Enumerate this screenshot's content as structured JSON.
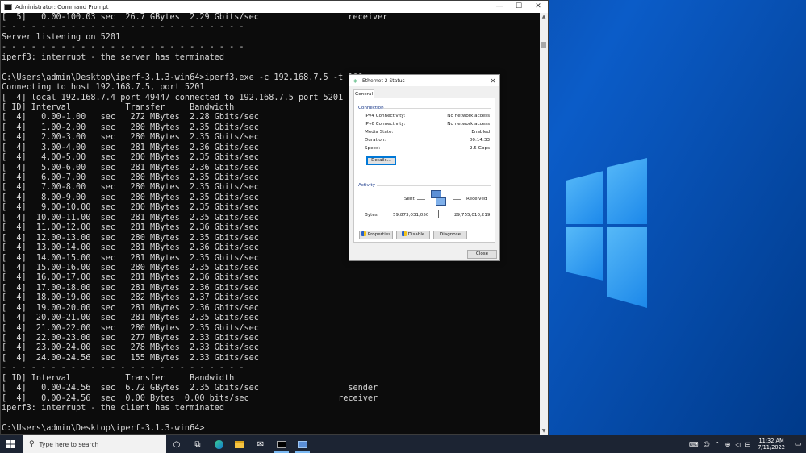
{
  "console": {
    "title": "Administrator: Command Prompt",
    "controls": {
      "minimize": "—",
      "maximize": "☐",
      "close": "✕"
    },
    "lines": [
      "[  5]   0.00-100.03 sec  26.7 GBytes  2.29 Gbits/sec                  receiver",
      "- - - - - - - - - - - - - - - - - - - - - - - - -",
      "Server listening on 5201",
      "- - - - - - - - - - - - - - - - - - - - - - - - -",
      "iperf3: interrupt - the server has terminated",
      "",
      "C:\\Users\\admin\\Desktop\\iperf-3.1.3-win64>iperf3.exe -c 192.168.7.5 -t 100",
      "Connecting to host 192.168.7.5, port 5201",
      "[  4] local 192.168.7.4 port 49447 connected to 192.168.7.5 port 5201",
      "[ ID] Interval           Transfer     Bandwidth",
      "[  4]   0.00-1.00   sec   272 MBytes  2.28 Gbits/sec",
      "[  4]   1.00-2.00   sec   280 MBytes  2.35 Gbits/sec",
      "[  4]   2.00-3.00   sec   280 MBytes  2.35 Gbits/sec",
      "[  4]   3.00-4.00   sec   281 MBytes  2.36 Gbits/sec",
      "[  4]   4.00-5.00   sec   280 MBytes  2.35 Gbits/sec",
      "[  4]   5.00-6.00   sec   281 MBytes  2.36 Gbits/sec",
      "[  4]   6.00-7.00   sec   280 MBytes  2.35 Gbits/sec",
      "[  4]   7.00-8.00   sec   280 MBytes  2.35 Gbits/sec",
      "[  4]   8.00-9.00   sec   280 MBytes  2.35 Gbits/sec",
      "[  4]   9.00-10.00  sec   280 MBytes  2.35 Gbits/sec",
      "[  4]  10.00-11.00  sec   281 MBytes  2.35 Gbits/sec",
      "[  4]  11.00-12.00  sec   281 MBytes  2.36 Gbits/sec",
      "[  4]  12.00-13.00  sec   280 MBytes  2.35 Gbits/sec",
      "[  4]  13.00-14.00  sec   281 MBytes  2.36 Gbits/sec",
      "[  4]  14.00-15.00  sec   281 MBytes  2.35 Gbits/sec",
      "[  4]  15.00-16.00  sec   280 MBytes  2.35 Gbits/sec",
      "[  4]  16.00-17.00  sec   281 MBytes  2.36 Gbits/sec",
      "[  4]  17.00-18.00  sec   281 MBytes  2.36 Gbits/sec",
      "[  4]  18.00-19.00  sec   282 MBytes  2.37 Gbits/sec",
      "[  4]  19.00-20.00  sec   281 MBytes  2.36 Gbits/sec",
      "[  4]  20.00-21.00  sec   281 MBytes  2.35 Gbits/sec",
      "[  4]  21.00-22.00  sec   280 MBytes  2.35 Gbits/sec",
      "[  4]  22.00-23.00  sec   277 MBytes  2.33 Gbits/sec",
      "[  4]  23.00-24.00  sec   278 MBytes  2.33 Gbits/sec",
      "[  4]  24.00-24.56  sec   155 MBytes  2.33 Gbits/sec",
      "- - - - - - - - - - - - - - - - - - - - - - - - -",
      "[ ID] Interval           Transfer     Bandwidth",
      "[  4]   0.00-24.56  sec  6.72 GBytes  2.35 Gbits/sec                  sender",
      "[  4]   0.00-24.56  sec  0.00 Bytes  0.00 bits/sec                  receiver",
      "iperf3: interrupt - the client has terminated",
      "",
      "C:\\Users\\admin\\Desktop\\iperf-3.1.3-win64>"
    ]
  },
  "dialog": {
    "title": "Ethernet 2 Status",
    "close_glyph": "✕",
    "tab": "General",
    "connection": {
      "label": "Connection",
      "rows": [
        {
          "label": "IPv4 Connectivity:",
          "value": "No network access"
        },
        {
          "label": "IPv6 Connectivity:",
          "value": "No network access"
        },
        {
          "label": "Media State:",
          "value": "Enabled"
        },
        {
          "label": "Duration:",
          "value": "00:14:33"
        },
        {
          "label": "Speed:",
          "value": "2.5 Gbps"
        }
      ],
      "details_button": "Details..."
    },
    "activity": {
      "label": "Activity",
      "sent_label": "Sent",
      "received_label": "Received",
      "bytes_label": "Bytes:",
      "bytes_sent": "59,873,031,050",
      "bytes_received": "29,755,010,219"
    },
    "buttons": {
      "properties": "Properties",
      "disable": "Disable",
      "diagnose": "Diagnose",
      "close": "Close"
    }
  },
  "taskbar": {
    "search_placeholder": "Type here to search",
    "clock_time": "11:32 AM",
    "clock_date": "7/11/2022"
  }
}
